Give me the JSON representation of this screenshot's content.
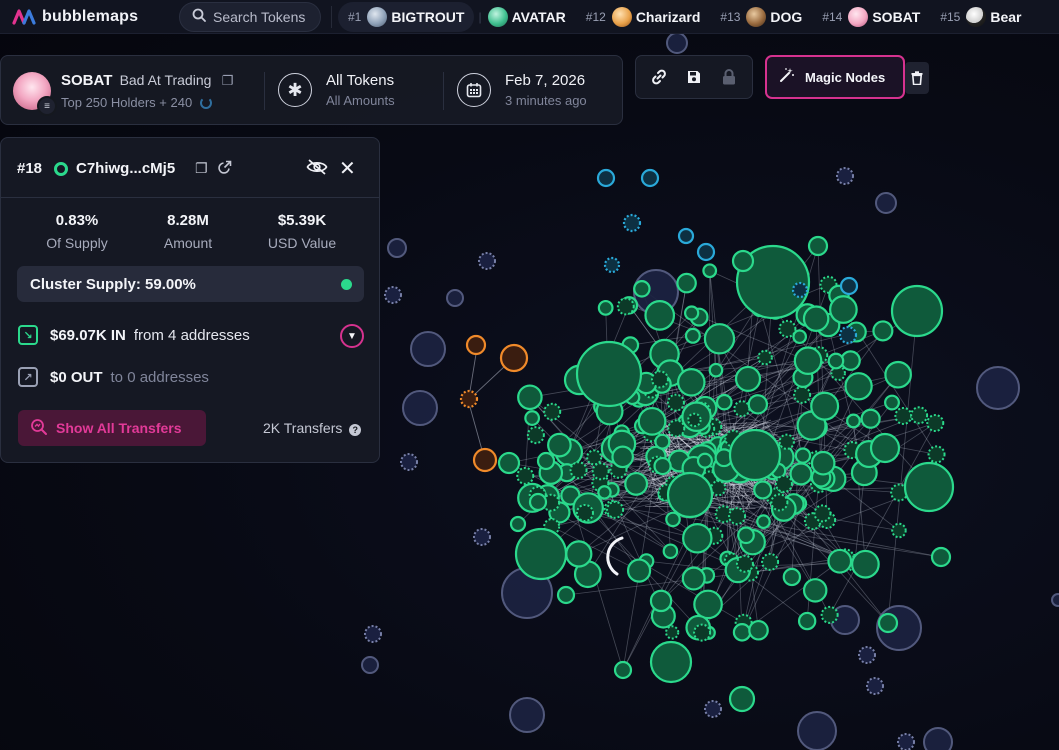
{
  "app": {
    "name": "bubblemaps"
  },
  "search": {
    "label": "Search Tokens"
  },
  "tickers": [
    {
      "rank": "#1",
      "symbol": "BIGTROUT",
      "color": "#8fa1b8",
      "active": true
    },
    {
      "rank": "",
      "symbol": "AVATAR",
      "color": "#3fbf8f",
      "active": false
    },
    {
      "rank": "#12",
      "symbol": "Charizard",
      "color": "#e9a24b",
      "active": false
    },
    {
      "rank": "#13",
      "symbol": "DOG",
      "color": "#9a6b3f",
      "active": false
    },
    {
      "rank": "#14",
      "symbol": "SOBAT",
      "color": "#f3a8c3",
      "active": false
    },
    {
      "rank": "#15",
      "symbol": "Bear",
      "color": "#e8e8e8",
      "active": false
    }
  ],
  "token": {
    "symbol": "SOBAT",
    "name": "Bad At Trading",
    "holders_label": "Top 250 Holders + 240",
    "filter_main": "All Tokens",
    "filter_sub": "All Amounts",
    "date": "Feb 7, 2026",
    "date_ago": "3 minutes ago"
  },
  "tools": {
    "link_icon": "link-icon",
    "save_icon": "save-icon",
    "lock_icon": "lock-icon",
    "magic_label": "Magic Nodes",
    "trash_icon": "trash-icon"
  },
  "holder": {
    "rank": "#18",
    "address": "C7hiwg...cMj5",
    "supply_value": "0.83%",
    "supply_label": "Of Supply",
    "amount_value": "8.28M",
    "amount_label": "Amount",
    "usd_value": "$5.39K",
    "usd_label": "USD Value",
    "cluster_supply": "Cluster Supply: 59.00%",
    "in_amount": "$69.07K IN",
    "in_from": "from 4 addresses",
    "out_amount": "$0 OUT",
    "out_to": "to 0 addresses",
    "show_transfers": "Show All Transfers",
    "transfers_count": "2K Transfers",
    "help_glyph": "?"
  },
  "colors": {
    "accent": "#d6328f",
    "cluster_green": "#2bd98c",
    "orange": "#f08a2a",
    "blue": "#2aa9d9",
    "neutral_bubble": "#5a6288"
  }
}
